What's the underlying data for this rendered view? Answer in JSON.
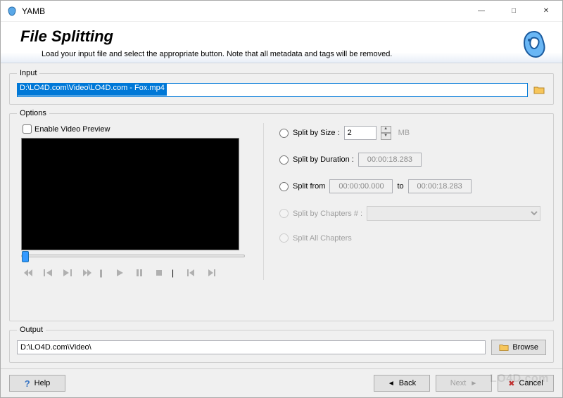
{
  "window": {
    "title": "YAMB"
  },
  "header": {
    "title": "File Splitting",
    "subtitle": "Load your input file and select the appropriate button. Note that all metadata and tags will be removed."
  },
  "input": {
    "legend": "Input",
    "value": "D:\\LO4D.com\\Video\\LO4D.com - Fox.mp4"
  },
  "options": {
    "legend": "Options",
    "enable_preview_label": "Enable Video Preview",
    "enable_preview_checked": false,
    "split_by_size": {
      "label": "Split by Size :",
      "value": "2",
      "unit": "MB"
    },
    "split_by_duration": {
      "label": "Split by Duration :",
      "value": "00:00:18.283"
    },
    "split_from": {
      "label": "Split from",
      "from": "00:00:00.000",
      "between": "to",
      "to": "00:00:18.283"
    },
    "split_by_chapters": {
      "label": "Split by Chapters # :"
    },
    "split_all": {
      "label": "Split All Chapters"
    }
  },
  "output": {
    "legend": "Output",
    "value": "D:\\LO4D.com\\Video\\",
    "browse_label": "Browse"
  },
  "footer": {
    "help": "Help",
    "back": "Back",
    "next": "Next",
    "cancel": "Cancel"
  },
  "watermark": "LO4D.com"
}
